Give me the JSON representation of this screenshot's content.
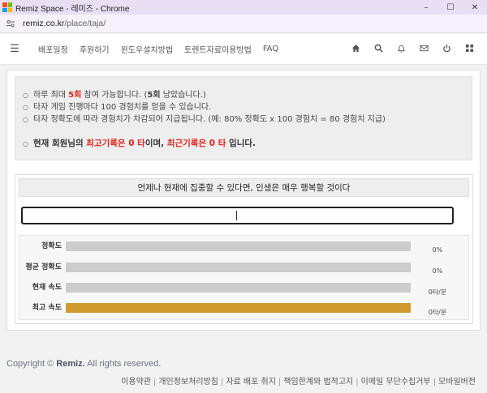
{
  "window": {
    "title": "Remiz Space - 레미즈 - Chrome",
    "controls": [
      "–",
      "☐",
      "✕"
    ],
    "favicon_colors": [
      "#f25022",
      "#7fba00",
      "#00a4ef",
      "#ffb900"
    ]
  },
  "address": {
    "host": "remiz.co.kr",
    "path": "/place/taja/"
  },
  "nav": {
    "items": [
      "배포일정",
      "후원하기",
      "윈도우설치방법",
      "토렌트자료이용방법",
      "FAQ"
    ],
    "icons": [
      "home-icon",
      "search-icon",
      "bell-icon",
      "mail-icon",
      "power-icon",
      "grid-icon"
    ]
  },
  "notice": {
    "line1_pre": "하루 최대 ",
    "line1_red": "5회",
    "line1_mid": " 참여 가능합니다. (",
    "line1_bold": "5회",
    "line1_post": " 남았습니다.)",
    "line2": "타자 게임 진행마다 100 경험치를 얻을 수 있습니다.",
    "line3": "타자 정확도에 따라 경험치가 차감되어 지급됩니다. (예: 80% 정확도 x 100 경험치 = 80 경험치 지급)",
    "summary_pre": "현재 회원님의 ",
    "summary_best": "최고기록은 0 타",
    "summary_mid": "이며, ",
    "summary_recent": "최근기록은 0 타",
    "summary_post": " 입니다."
  },
  "typing": {
    "sentence": "언제나 현재에 집중할 수 있다면, 인생은 매우 행복할 것이다"
  },
  "stats": [
    {
      "label": "정확도",
      "value": "0%",
      "fill": 0,
      "color": "#cccccc"
    },
    {
      "label": "평균 정확도",
      "value": "0%",
      "fill": 0,
      "color": "#cccccc"
    },
    {
      "label": "현재 속도",
      "value": "0타/분",
      "fill": 0,
      "color": "#cccccc"
    },
    {
      "label": "최고 속도",
      "value": "0타/분",
      "fill": 1,
      "color": "#d19a2e"
    }
  ],
  "footer": {
    "copy_pre": "Copyright © ",
    "copy_brand": "Remiz.",
    "copy_post": " All rights reserved.",
    "links": [
      "이용약관",
      "개인정보처리방침",
      "자료 배포 취지",
      "책임한계와 법적고지",
      "이메일 무단수집거부",
      "모바일버전"
    ]
  }
}
